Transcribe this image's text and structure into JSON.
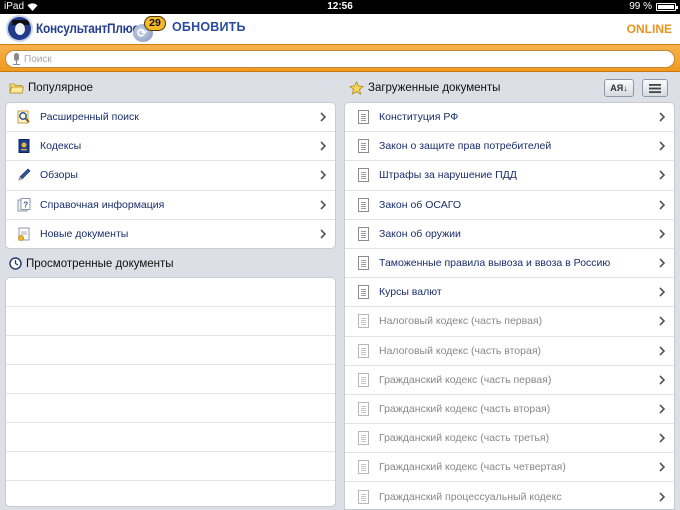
{
  "status_bar": {
    "device": "iPad",
    "time": "12:56",
    "battery": "99 %",
    "battery_level": 0.99
  },
  "header": {
    "logo_text": "КонсультантПлюс",
    "badge_count": "29",
    "update_label": "ОБНОВИТЬ",
    "online_label": "ONLINE"
  },
  "search": {
    "placeholder": "Поиск",
    "value": ""
  },
  "popular": {
    "title": "Популярное",
    "items": [
      {
        "label": "Расширенный поиск",
        "icon": "magnifier-icon"
      },
      {
        "label": "Кодексы",
        "icon": "codex-book-icon"
      },
      {
        "label": "Обзоры",
        "icon": "pen-icon"
      },
      {
        "label": "Справочная информация",
        "icon": "help-doc-icon"
      },
      {
        "label": "Новые документы",
        "icon": "new-document-icon"
      }
    ]
  },
  "viewed": {
    "title": "Просмотренные документы",
    "items": []
  },
  "loaded": {
    "title": "Загруженные документы",
    "sort_label": "АЯ↓",
    "items": [
      {
        "label": "Конституция РФ",
        "available": true
      },
      {
        "label": "Закон о защите прав потребителей",
        "available": true
      },
      {
        "label": "Штрафы за нарушение ПДД",
        "available": true
      },
      {
        "label": "Закон об ОСАГО",
        "available": true
      },
      {
        "label": "Закон об оружии",
        "available": true
      },
      {
        "label": "Таможенные правила вывоза и ввоза в Россию",
        "available": true
      },
      {
        "label": "Курсы валют",
        "available": true
      },
      {
        "label": "Налоговый кодекс (часть первая)",
        "available": false
      },
      {
        "label": "Налоговый кодекс (часть вторая)",
        "available": false
      },
      {
        "label": "Гражданский кодекс (часть первая)",
        "available": false
      },
      {
        "label": "Гражданский кодекс (часть вторая)",
        "available": false
      },
      {
        "label": "Гражданский кодекс (часть третья)",
        "available": false
      },
      {
        "label": "Гражданский кодекс (часть четвертая)",
        "available": false
      },
      {
        "label": "Гражданский процессуальный кодекс",
        "available": false
      }
    ]
  },
  "colors": {
    "accent_orange": "#f09a1e",
    "link_blue": "#1a2d6b",
    "brand_blue": "#233d8f",
    "disabled_grey": "#888888"
  }
}
